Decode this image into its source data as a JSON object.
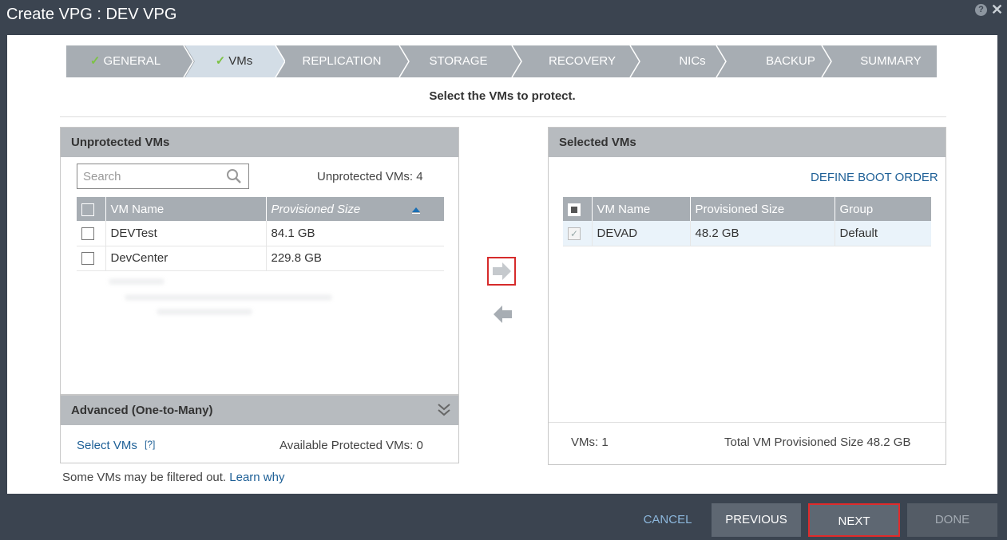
{
  "window": {
    "title": "Create VPG : DEV VPG",
    "help": "?",
    "close": "✕"
  },
  "steps": [
    {
      "label": "GENERAL",
      "done": true
    },
    {
      "label": "VMs",
      "done": true,
      "active": true
    },
    {
      "label": "REPLICATION"
    },
    {
      "label": "STORAGE"
    },
    {
      "label": "RECOVERY"
    },
    {
      "label": "NICs"
    },
    {
      "label": "BACKUP"
    },
    {
      "label": "SUMMARY"
    }
  ],
  "check_glyph": "✓",
  "instruction": "Select the VMs to protect.",
  "unprotected": {
    "title": "Unprotected VMs",
    "search_placeholder": "Search",
    "count_text": "Unprotected VMs: 4",
    "columns": [
      "VM Name",
      "Provisioned Size"
    ],
    "rows": [
      {
        "name": "DEVTest",
        "size": "84.1 GB"
      },
      {
        "name": "DevCenter",
        "size": "229.8 GB"
      }
    ]
  },
  "advanced": {
    "title": "Advanced (One-to-Many)",
    "select_vms": "Select VMs",
    "help": "[?]",
    "available_text": "Available Protected VMs: 0"
  },
  "selected": {
    "title": "Selected VMs",
    "define_boot_order": "DEFINE BOOT ORDER",
    "columns": [
      "VM Name",
      "Provisioned Size",
      "Group"
    ],
    "rows": [
      {
        "name": "DEVAD",
        "size": "48.2 GB",
        "group": "Default"
      }
    ],
    "vms_count": "VMs: 1",
    "total_text": "Total VM Provisioned Size 48.2 GB"
  },
  "filtered_note": {
    "text": "Some VMs may be filtered out.",
    "link": "Learn why"
  },
  "footer": {
    "cancel": "CANCEL",
    "previous": "PREVIOUS",
    "next": "NEXT",
    "done": "DONE"
  },
  "colors": {
    "accent_link": "#1d5f96",
    "highlight": "#d62b2b",
    "check": "#7dc246"
  }
}
